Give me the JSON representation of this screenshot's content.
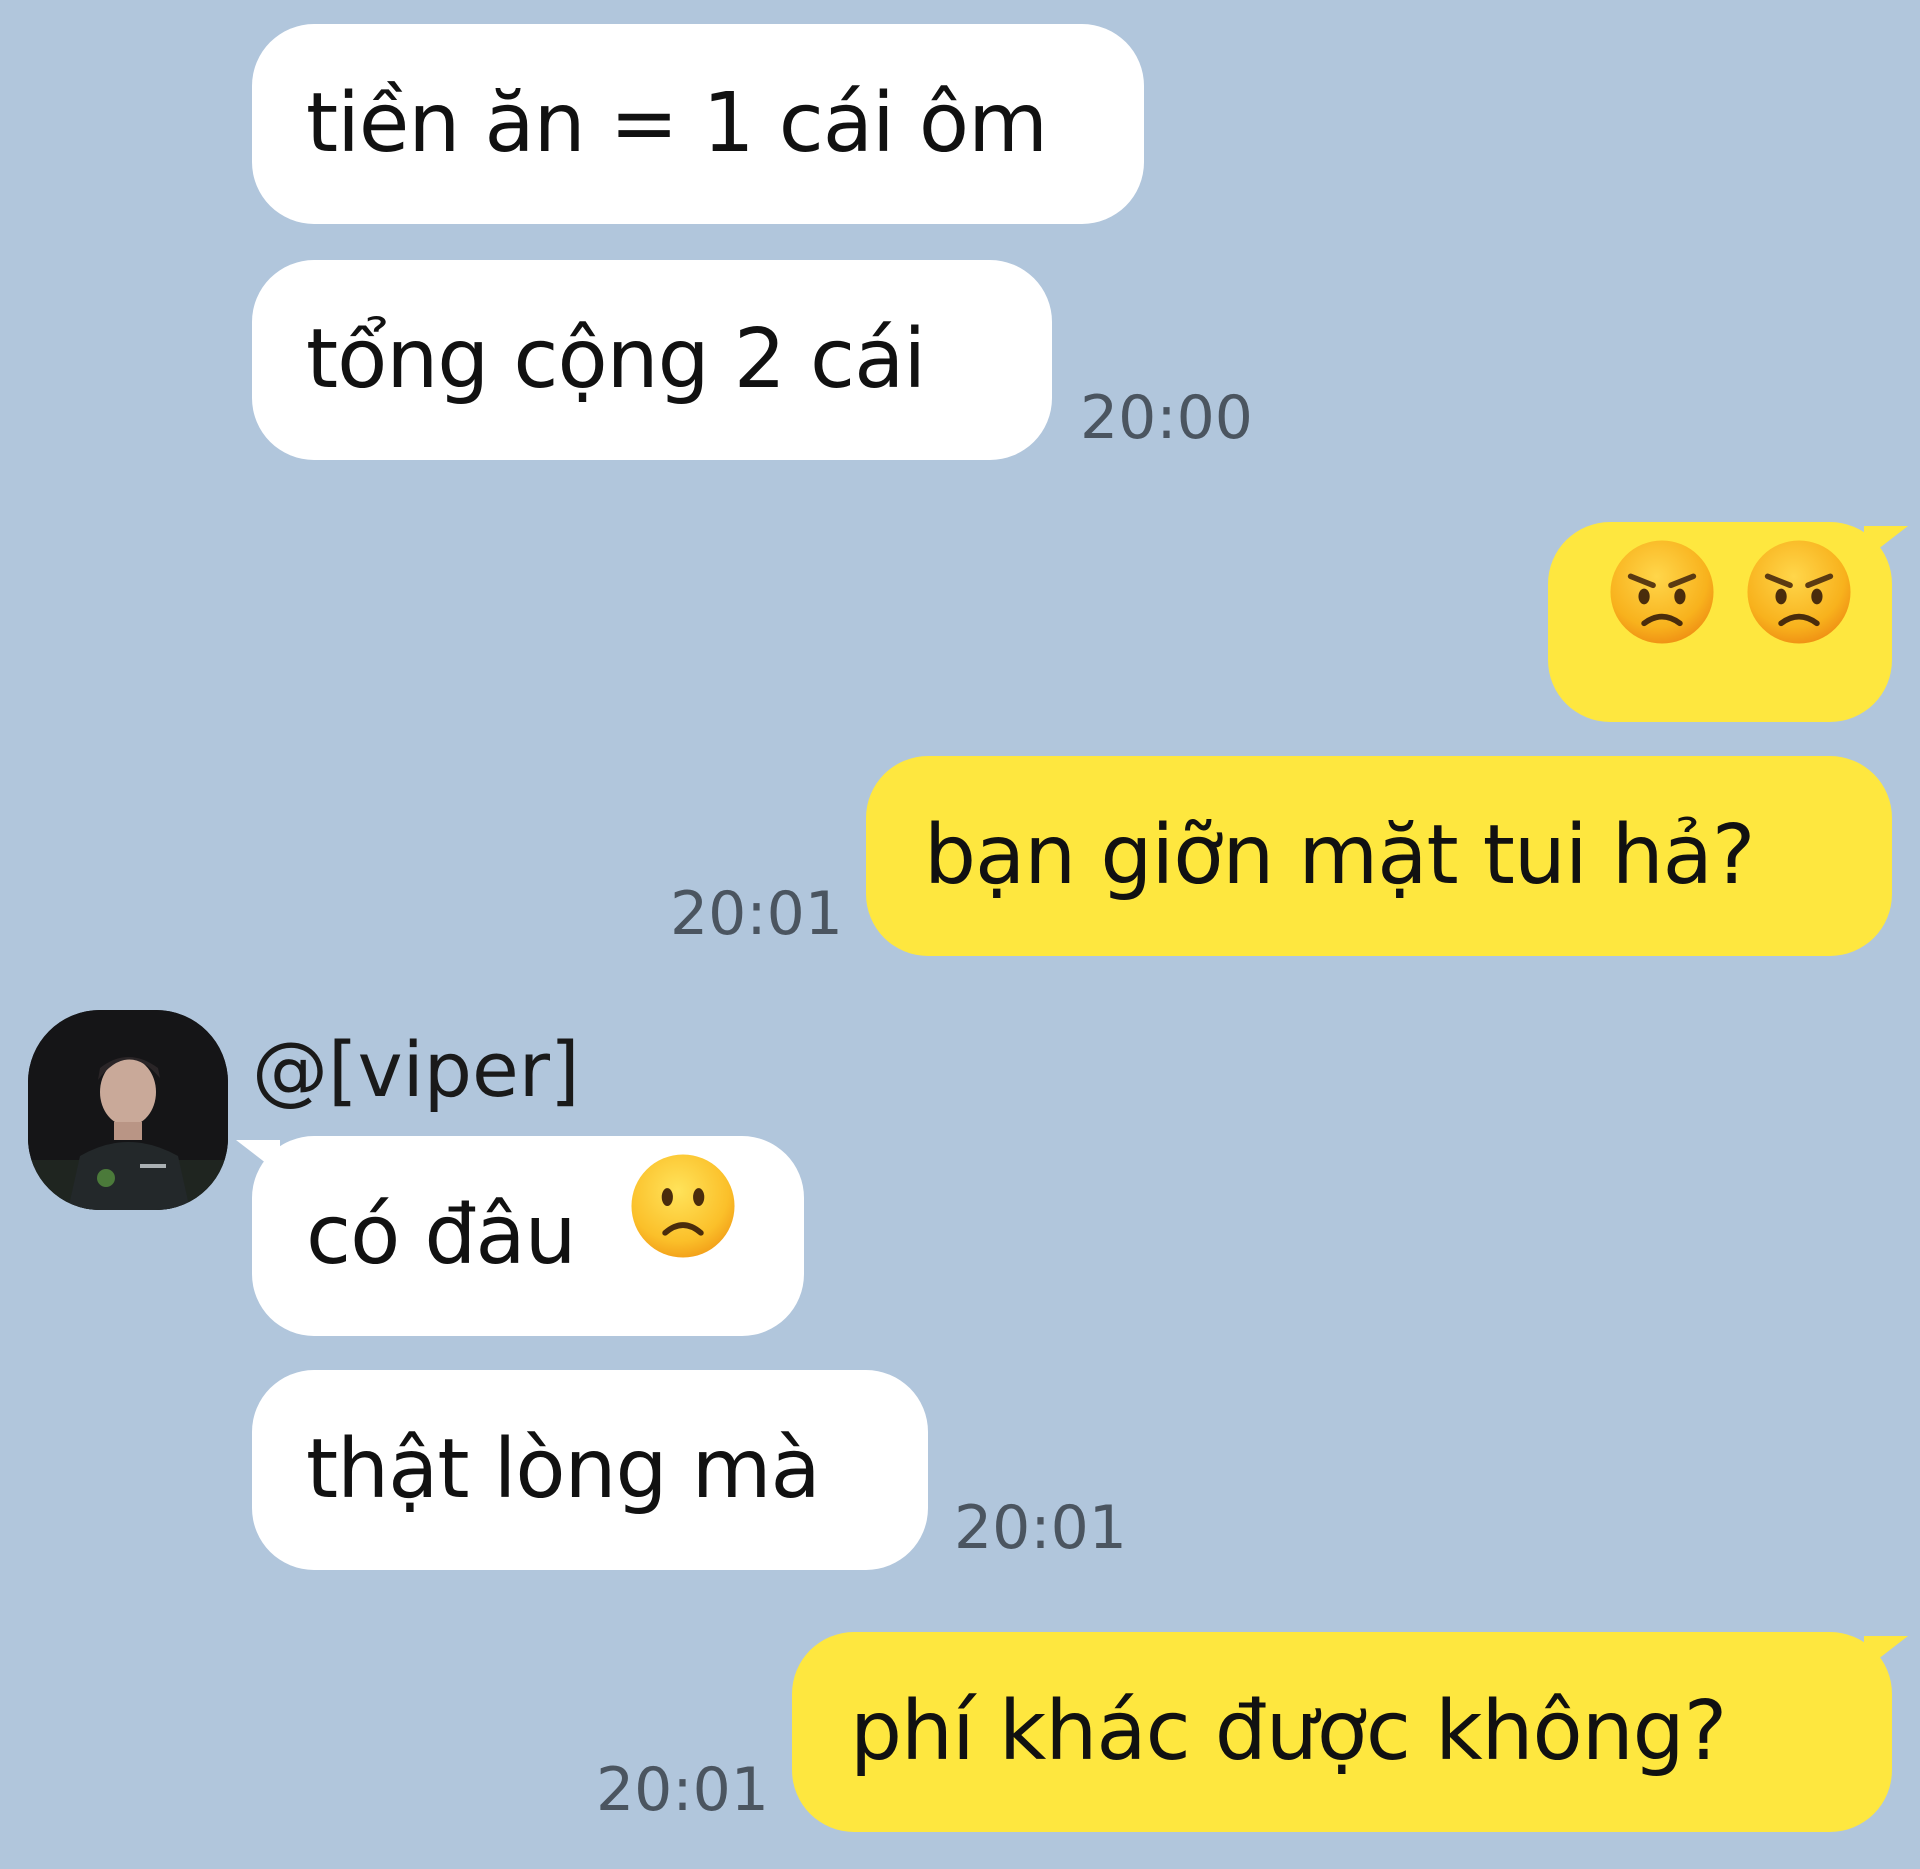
{
  "colors": {
    "background": "#b1c6dc",
    "incoming_bubble": "#ffffff",
    "outgoing_bubble": "#fee73f",
    "timestamp": "#4b5560"
  },
  "messages": {
    "m1": {
      "direction": "incoming",
      "text": "tiền ăn = 1 cái ôm"
    },
    "m2": {
      "direction": "incoming",
      "text": "tổng cộng 2 cái",
      "time": "20:00"
    },
    "m3": {
      "direction": "outgoing",
      "emoji": [
        "pouting-face",
        "pouting-face"
      ]
    },
    "m4": {
      "direction": "outgoing",
      "text": "bạn giỡn mặt tui hả?",
      "time": "20:01"
    },
    "m5": {
      "direction": "incoming",
      "text": "có đâu",
      "emoji": "slightly-frowning-face"
    },
    "m6": {
      "direction": "incoming",
      "text": "thật lòng mà",
      "time": "20:01"
    },
    "m7": {
      "direction": "outgoing",
      "text": "phí khác được không?",
      "time": "20:01"
    }
  },
  "sender": {
    "name": "@[viper]",
    "avatar": "profile-photo"
  }
}
